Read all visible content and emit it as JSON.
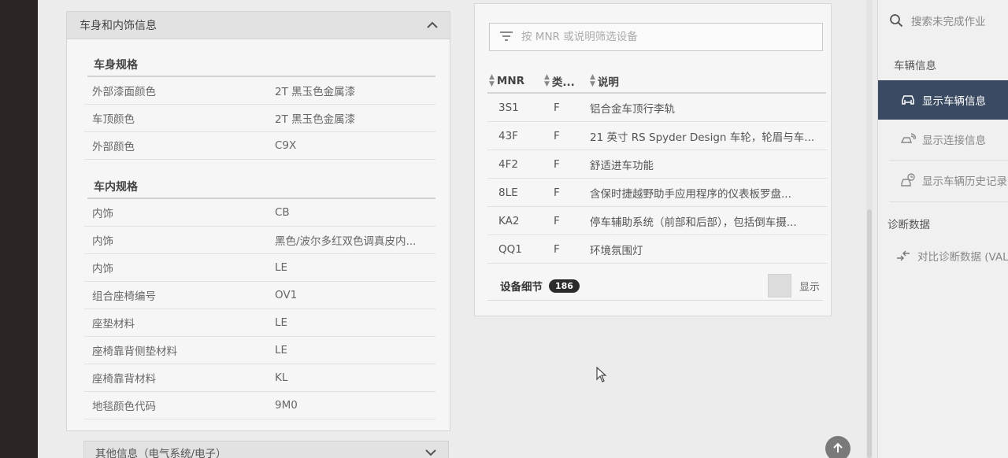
{
  "left_panel": {
    "title": "车身和内饰信息",
    "body_section": {
      "title": "车身规格",
      "rows": [
        {
          "label": "外部漆面颜色",
          "value": "2T 黑玉色金属漆"
        },
        {
          "label": "车顶颜色",
          "value": "2T 黑玉色金属漆"
        },
        {
          "label": "外部颜色",
          "value": "C9X"
        }
      ]
    },
    "interior_section": {
      "title": "车内规格",
      "rows": [
        {
          "label": "内饰",
          "value": "CB"
        },
        {
          "label": "内饰",
          "value": "黑色/波尔多红双色调真皮内..."
        },
        {
          "label": "内饰",
          "value": "LE"
        },
        {
          "label": "组合座椅编号",
          "value": "OV1"
        },
        {
          "label": "座垫材料",
          "value": "LE"
        },
        {
          "label": "座椅靠背侧垫材料",
          "value": "LE"
        },
        {
          "label": "座椅靠背材料",
          "value": "KL"
        },
        {
          "label": "地毯颜色代码",
          "value": "9M0"
        }
      ]
    },
    "next_section_title": "其他信息（电气系统/电子）"
  },
  "equipment": {
    "filter_placeholder": "按 MNR 或说明筛选设备",
    "columns": {
      "mnr": "MNR",
      "type": "类...",
      "desc": "说明"
    },
    "rows": [
      {
        "mnr": "3S1",
        "type": "F",
        "desc": "铝合金车顶行李轨"
      },
      {
        "mnr": "43F",
        "type": "F",
        "desc": "21 英寸 RS Spyder Design 车轮，轮眉与车..."
      },
      {
        "mnr": "4F2",
        "type": "F",
        "desc": "舒适进车功能"
      },
      {
        "mnr": "8LE",
        "type": "F",
        "desc": "含保时捷越野助手应用程序的仪表板罗盘..."
      },
      {
        "mnr": "KA2",
        "type": "F",
        "desc": "停车辅助系统（前部和后部），包括倒车摄..."
      },
      {
        "mnr": "QQ1",
        "type": "F",
        "desc": "环境氛围灯"
      }
    ],
    "detail_label": "设备细节",
    "detail_count": "186",
    "show_label": "显示"
  },
  "sidebar": {
    "search_text": "搜索未完成作业",
    "vehicle_section": "车辆信息",
    "items": [
      {
        "label": "显示车辆信息",
        "icon": "car-icon",
        "active": true
      },
      {
        "label": "显示连接信息",
        "icon": "connection-icon",
        "active": false
      },
      {
        "label": "显示车辆历史记录",
        "icon": "history-icon",
        "active": false
      }
    ],
    "diag_section": "诊断数据",
    "diag_item": "对比诊断数据 (VAL)"
  },
  "colors": {
    "active_item": "#3a4a62",
    "badge": "#2b2b2b"
  }
}
